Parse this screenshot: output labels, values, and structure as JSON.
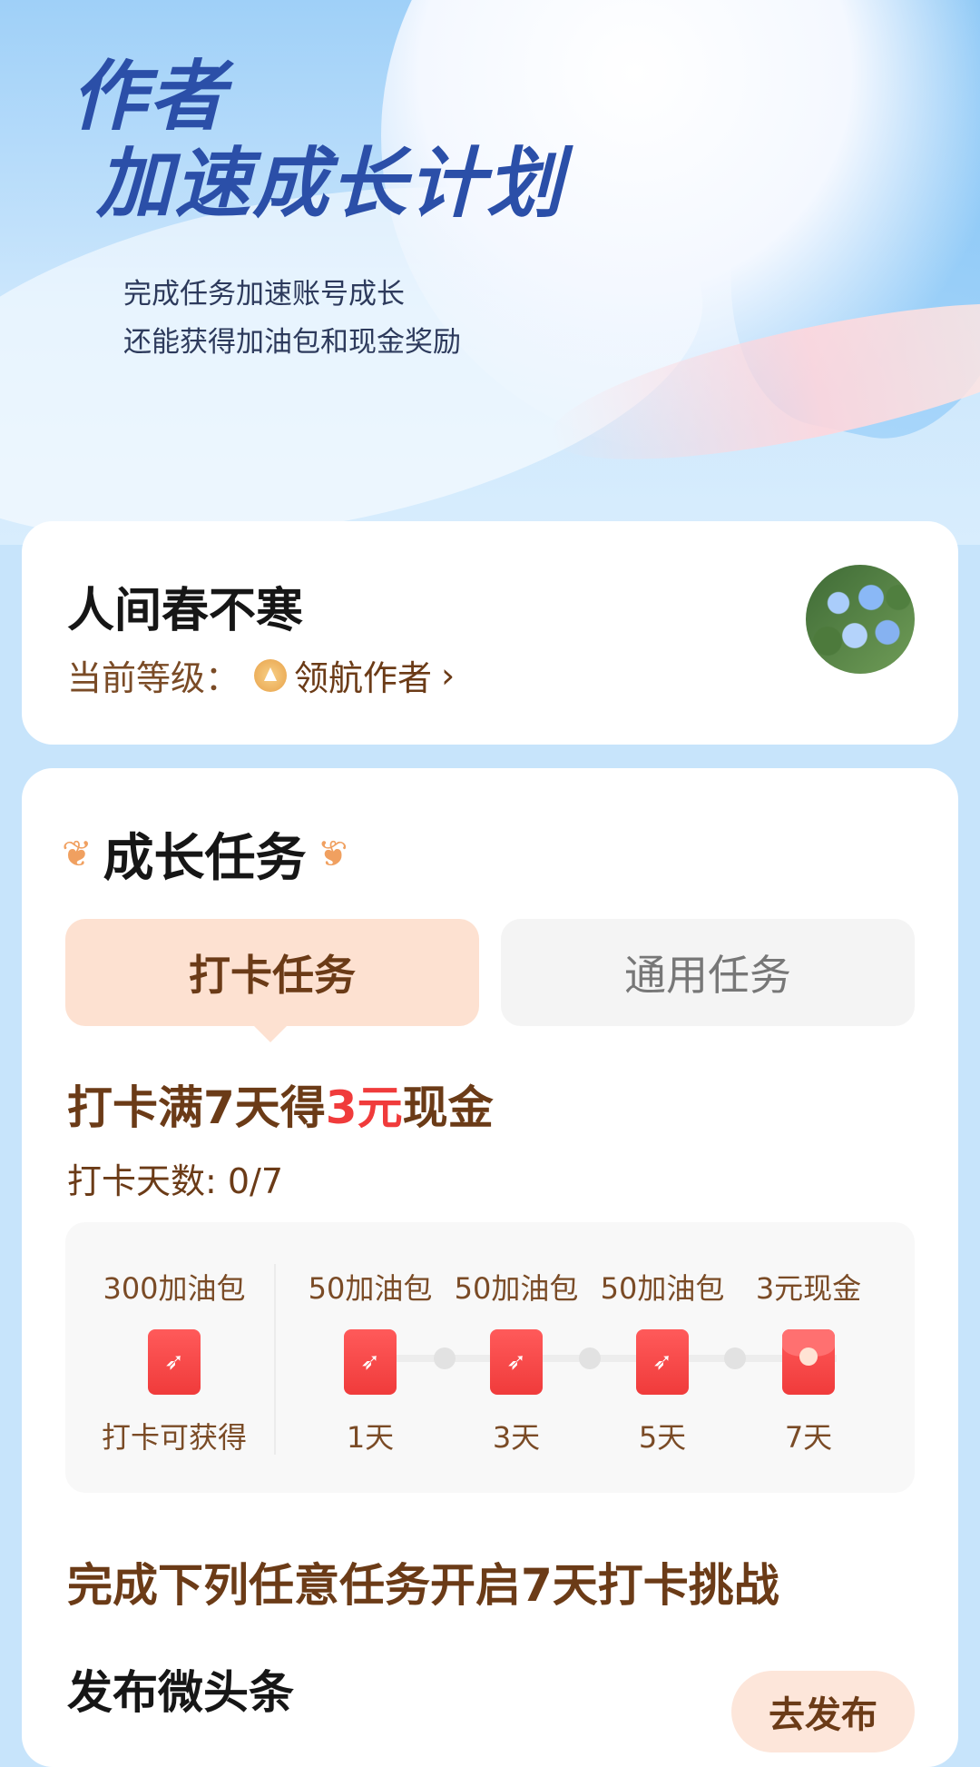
{
  "hero": {
    "title_line1": "作者",
    "title_line2": "加速成长计划",
    "subtitle_line1": "完成任务加速账号成长",
    "subtitle_line2": "还能获得加油包和现金奖励"
  },
  "profile": {
    "username": "人间春不寒",
    "level_label": "当前等级：",
    "level_name": "领航作者",
    "level_chevron": "›"
  },
  "growth_tasks": {
    "section_title": "成长任务",
    "tabs": [
      {
        "label": "打卡任务",
        "active": true
      },
      {
        "label": "通用任务",
        "active": false
      }
    ],
    "checkin": {
      "title_prefix": "打卡满7天得",
      "title_highlight": "3元",
      "title_suffix": "现金",
      "count_text": "打卡天数: 0/7"
    },
    "rewards": [
      {
        "label": "300加油包",
        "day": "打卡可获得",
        "icon": "rocket-envelope-icon"
      },
      {
        "label": "50加油包",
        "day": "1天",
        "icon": "rocket-envelope-icon"
      },
      {
        "label": "50加油包",
        "day": "3天",
        "icon": "rocket-envelope-icon"
      },
      {
        "label": "50加油包",
        "day": "5天",
        "icon": "rocket-envelope-icon"
      },
      {
        "label": "3元现金",
        "day": "7天",
        "icon": "cash-envelope-icon"
      }
    ],
    "challenge_title": "完成下列任意任务开启7天打卡挑战",
    "task": {
      "name": "发布微头条",
      "button_label": "去发布"
    }
  },
  "colors": {
    "accent_brown": "#6b3b17",
    "highlight_red": "#f03b3b",
    "tab_active_bg": "#fde1d1",
    "page_bg": "#c7e4fb"
  }
}
